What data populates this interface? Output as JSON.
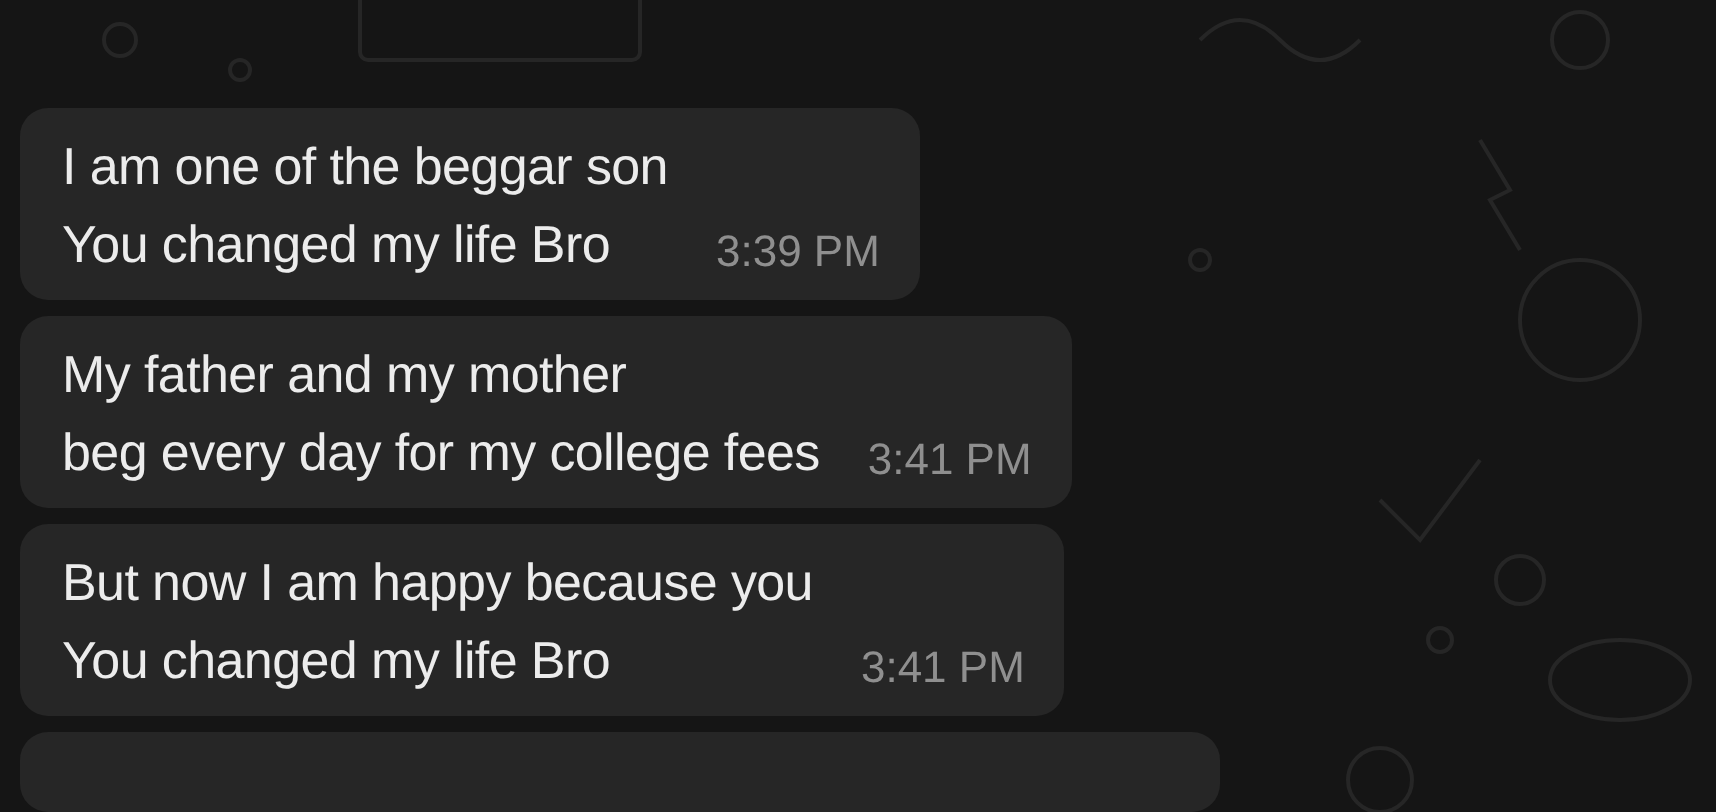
{
  "messages": [
    {
      "text": "I am one of the beggar son\nYou changed my life Bro",
      "time": "3:39 PM"
    },
    {
      "text": "My father and my mother\nbeg every day for my college fees",
      "time": "3:41 PM"
    },
    {
      "text": "But now I am happy because you\nYou changed my life Bro",
      "time": "3:41 PM"
    }
  ]
}
